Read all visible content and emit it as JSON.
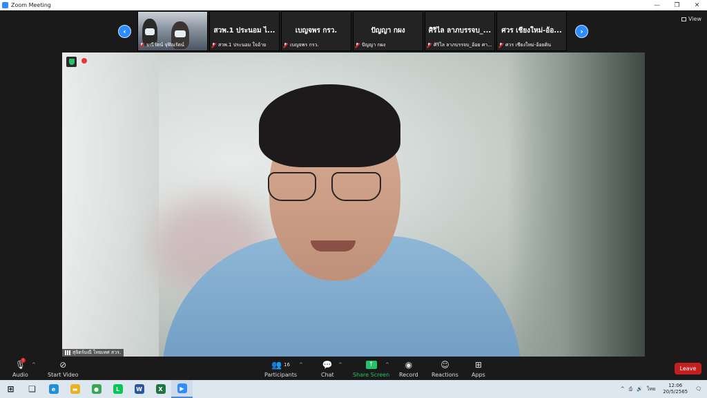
{
  "window": {
    "title": "Zoom Meeting",
    "min": "—",
    "restore": "❐",
    "close": "✕"
  },
  "strip": {
    "prev": "‹",
    "next": "›",
    "view_label": "View",
    "tiles": [
      {
        "big": "",
        "caption": "มณีรัตน์ จุฬิณรัตน์"
      },
      {
        "big": "สวพ.1 ประนอม ไ...",
        "caption": "สวพ.1 ประนอม ใจอ้าย"
      },
      {
        "big": "เบญจพร กรว.",
        "caption": "เบญจพร กรว."
      },
      {
        "big": "ปัญญา กผง",
        "caption": "ปัญญา กผง"
      },
      {
        "big": "ศิริไล ลาภบรรจบ_...",
        "caption": "ศิริไล ลาภบรรจบ_อ้อย ศา..."
      },
      {
        "big": "ศวร เชียงใหม่-อ้อ...",
        "caption": "ศวร เชียงใหม่-อ้อยดิน"
      }
    ]
  },
  "main": {
    "recording_label": "Recording",
    "speaker_name": "สุจิตร์มณี ไทยเทศ สวร."
  },
  "toolbar": {
    "audio": {
      "label": "Audio",
      "badge": "!"
    },
    "video": {
      "label": "Start Video"
    },
    "participants": {
      "label": "Participants",
      "count": "16"
    },
    "chat": {
      "label": "Chat"
    },
    "share": {
      "label": "Share Screen",
      "icon": "↑"
    },
    "record": {
      "label": "Record"
    },
    "reactions": {
      "label": "Reactions"
    },
    "apps": {
      "label": "Apps"
    },
    "caret": "^",
    "leave": "Leave"
  },
  "taskbar": {
    "apps": [
      {
        "name": "windows-start",
        "glyph": "⊞",
        "color": "#1a1a1a"
      },
      {
        "name": "task-view",
        "glyph": "❏",
        "color": "#333333"
      },
      {
        "name": "edge",
        "glyph": "e",
        "color": "#1f8fd8"
      },
      {
        "name": "file-explorer",
        "glyph": "▬",
        "color": "#e8b322"
      },
      {
        "name": "chrome",
        "glyph": "●",
        "color": "#34a853"
      },
      {
        "name": "line",
        "glyph": "L",
        "color": "#06c755"
      },
      {
        "name": "word",
        "glyph": "W",
        "color": "#2b579a"
      },
      {
        "name": "excel",
        "glyph": "X",
        "color": "#217346"
      },
      {
        "name": "zoom",
        "glyph": "▶",
        "color": "#2d8cff"
      }
    ],
    "lang": "ไทย",
    "time": "12:06",
    "date": "20/5/2565"
  }
}
